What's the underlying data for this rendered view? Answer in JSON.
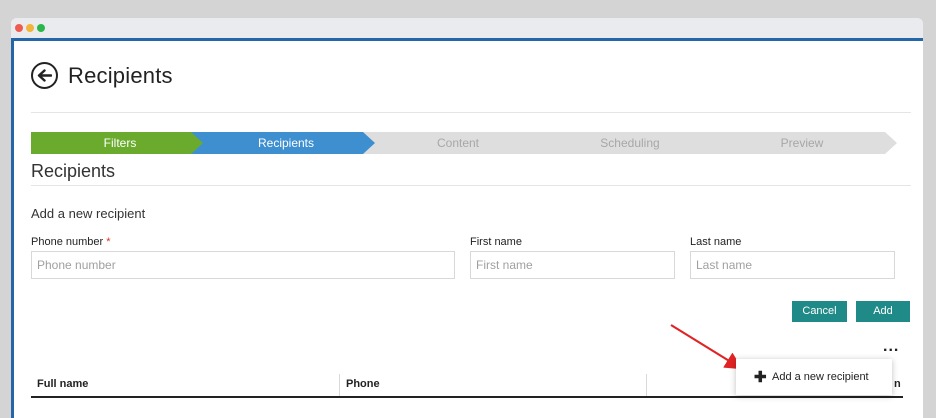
{
  "window": {
    "controls": [
      "close",
      "minimize",
      "maximize"
    ]
  },
  "header": {
    "title": "Recipients",
    "back_icon": "arrow-left-circle-icon"
  },
  "steps": [
    {
      "label": "Filters",
      "state": "done"
    },
    {
      "label": "Recipients",
      "state": "active"
    },
    {
      "label": "Content",
      "state": "pending"
    },
    {
      "label": "Scheduling",
      "state": "pending"
    },
    {
      "label": "Preview",
      "state": "pending"
    }
  ],
  "section": {
    "title": "Recipients"
  },
  "form": {
    "title": "Add a new recipient",
    "phone": {
      "label": "Phone number",
      "required_mark": "*",
      "placeholder": "Phone number",
      "value": ""
    },
    "first": {
      "label": "First name",
      "placeholder": "First name",
      "value": ""
    },
    "last": {
      "label": "Last name",
      "placeholder": "Last name",
      "value": ""
    },
    "cancel_label": "Cancel",
    "add_label": "Add"
  },
  "more_menu": {
    "label": "...",
    "item_label": "Add a new recipient",
    "item_icon": "plus-icon"
  },
  "table": {
    "columns": [
      "Full name",
      "Phone"
    ],
    "partial_column_end": "n"
  },
  "colors": {
    "accent_blue": "#3d8fd0",
    "step_done": "#6aab2e",
    "step_pending": "#dedede",
    "button_teal": "#1f8a87",
    "arrow_red": "#e02424"
  }
}
